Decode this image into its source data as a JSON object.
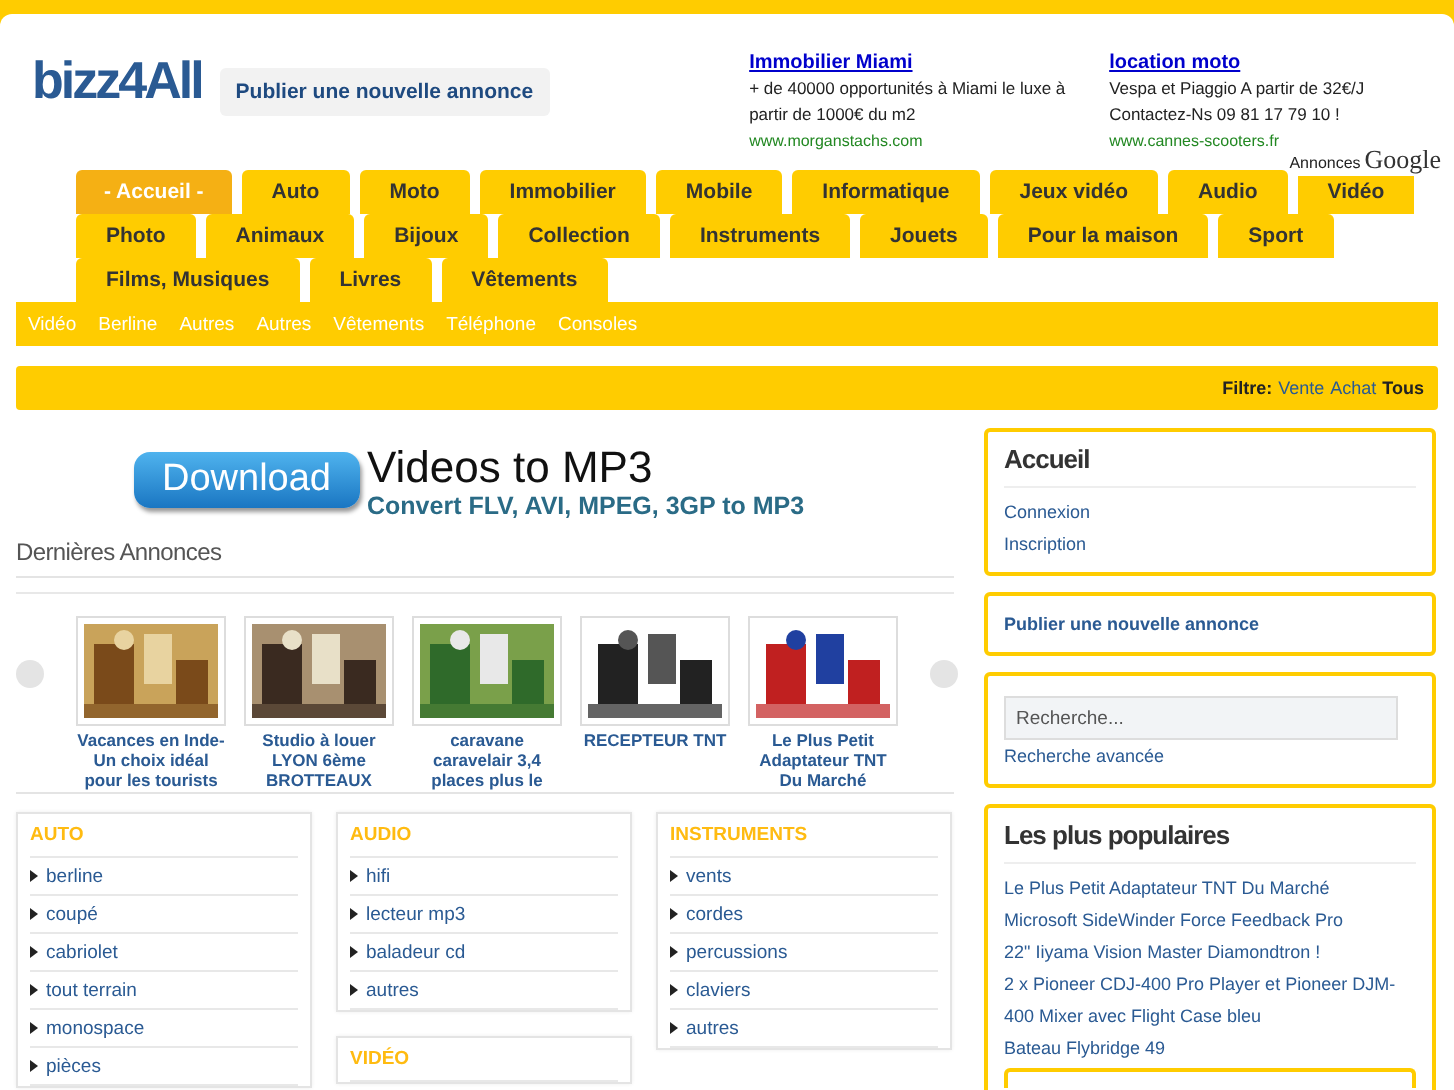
{
  "header": {
    "logo": "bizz4All",
    "publish_button": "Publier une nouvelle annonce",
    "ads": [
      {
        "title": "Immobilier Miami",
        "text": "+ de 40000 opportunités à Miami le luxe à partir de 1000€ du m2",
        "url": "www.morganstachs.com"
      },
      {
        "title": "location moto",
        "text": "Vespa et Piaggio A partir de 32€/J Contactez-Ns 09 81 17 79 10 !",
        "url": "www.cannes-scooters.fr"
      }
    ],
    "ads_label": "Annonces",
    "ads_brand": "Google"
  },
  "nav_rows": [
    [
      {
        "label": "- Accueil -",
        "selected": true
      },
      {
        "label": "Auto",
        "selected": false
      },
      {
        "label": "Moto",
        "selected": false
      },
      {
        "label": "Immobilier",
        "selected": false
      },
      {
        "label": "Mobile",
        "selected": false
      },
      {
        "label": "Informatique",
        "selected": false
      },
      {
        "label": "Jeux vidéo",
        "selected": false
      },
      {
        "label": "Audio",
        "selected": false
      },
      {
        "label": "Vidéo",
        "selected": false
      }
    ],
    [
      {
        "label": "Photo",
        "selected": false
      },
      {
        "label": "Animaux",
        "selected": false
      },
      {
        "label": "Bijoux",
        "selected": false
      },
      {
        "label": "Collection",
        "selected": false
      },
      {
        "label": "Instruments",
        "selected": false
      },
      {
        "label": "Jouets",
        "selected": false
      },
      {
        "label": "Pour la maison",
        "selected": false
      },
      {
        "label": "Sport",
        "selected": false
      }
    ],
    [
      {
        "label": "Films, Musiques",
        "selected": false
      },
      {
        "label": "Livres",
        "selected": false
      },
      {
        "label": "Vêtements",
        "selected": false
      }
    ]
  ],
  "subnav": [
    "Vidéo",
    "Berline",
    "Autres",
    "Autres",
    "Vêtements",
    "Téléphone",
    "Consoles"
  ],
  "filter": {
    "label": "Filtre:",
    "options": [
      {
        "label": "Vente",
        "selected": false
      },
      {
        "label": "Achat",
        "selected": false
      },
      {
        "label": "Tous",
        "selected": true
      }
    ]
  },
  "banner": {
    "button": "Download",
    "title": "Videos to MP3",
    "subtitle": "Convert FLV, AVI, MPEG, 3GP to MP3"
  },
  "latest": {
    "title": "Dernières Annonces",
    "items": [
      {
        "caption": "Vacances en Inde- Un choix idéal pour les tourists"
      },
      {
        "caption": "Studio à louer LYON 6ème BROTTEAUX"
      },
      {
        "caption": "caravane caravelair 3,4 places plus le"
      },
      {
        "caption": "RECEPTEUR TNT"
      },
      {
        "caption": "Le Plus Petit Adaptateur TNT Du Marché"
      }
    ]
  },
  "categories": [
    [
      {
        "title": "AUTO",
        "items": [
          "berline",
          "coupé",
          "cabriolet",
          "tout terrain",
          "monospace",
          "pièces"
        ]
      }
    ],
    [
      {
        "title": "AUDIO",
        "items": [
          "hifi",
          "lecteur mp3",
          "baladeur cd",
          "autres"
        ]
      },
      {
        "title": "VIDÉO"
      }
    ],
    [
      {
        "title": "INSTRUMENTS",
        "items": [
          "vents",
          "cordes",
          "percussions",
          "claviers",
          "autres"
        ]
      }
    ]
  ],
  "sidebar": {
    "home": {
      "title": "Accueil",
      "links": [
        "Connexion",
        "Inscription"
      ]
    },
    "publish": "Publier une nouvelle annonce",
    "search": {
      "placeholder": "Recherche...",
      "advanced": "Recherche avancée"
    },
    "popular": {
      "title": "Les plus populaires",
      "links": [
        "Le Plus Petit Adaptateur TNT Du Marché",
        "Microsoft SideWinder Force Feedback Pro",
        "22\" Iiyama Vision Master Diamondtron !",
        "2 x Pioneer CDJ-400 Pro Player et Pioneer DJM-400 Mixer avec Flight Case bleu",
        "Bateau Flybridge 49"
      ]
    }
  }
}
